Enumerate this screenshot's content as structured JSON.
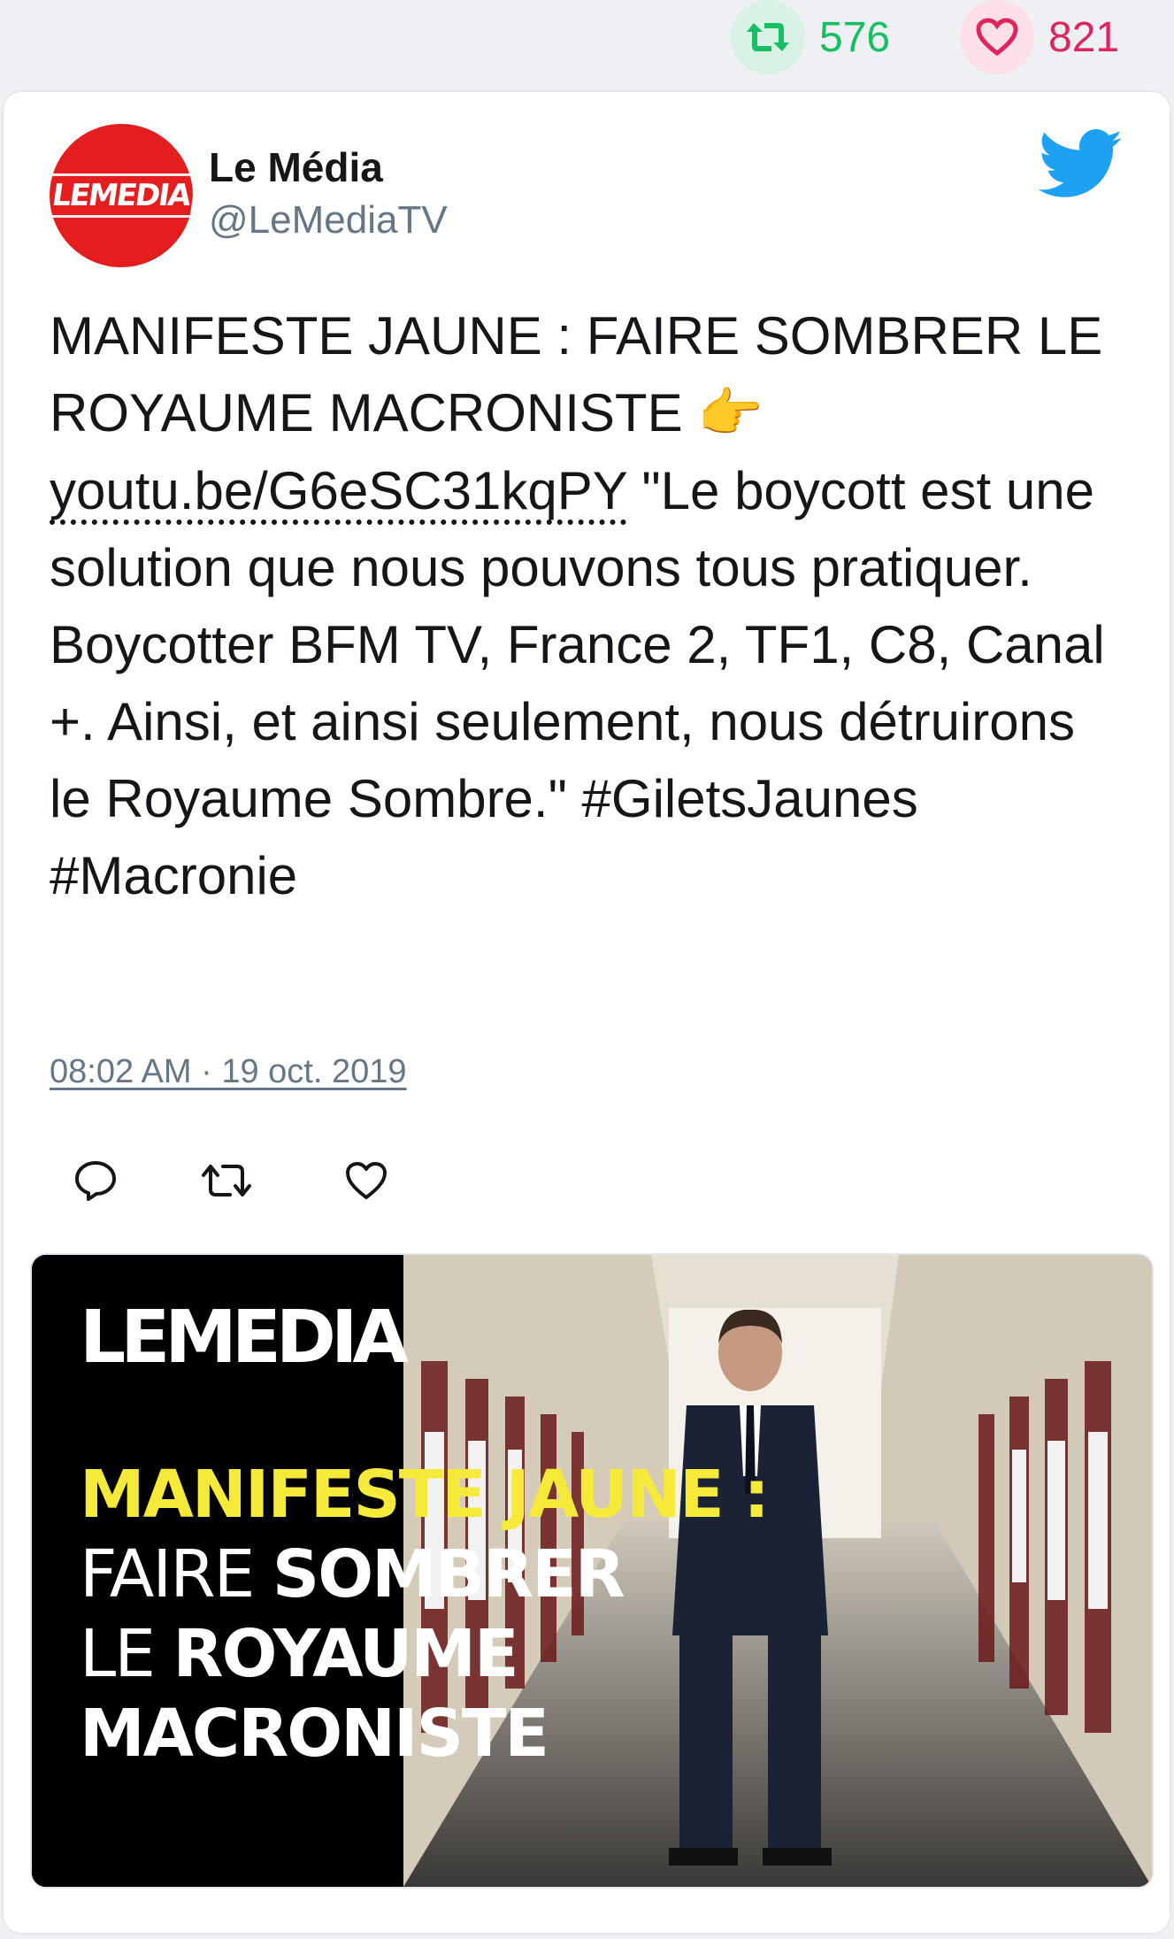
{
  "stats": {
    "retweets": "576",
    "likes": "821",
    "retweet_icon": "retweet-icon",
    "like_icon": "heart-icon"
  },
  "author": {
    "name": "Le Média",
    "handle": "@LeMediaTV",
    "avatar_text": "LEMEDIA"
  },
  "tweet": {
    "text_part1": "MANIFESTE JAUNE : FAIRE SOMBRER LE ROYAUME MACRONISTE ",
    "emoji": "👉",
    "link": "youtu.be/G6eSC31kqPY",
    "text_part2": " \"Le boycott est une solution que nous pouvons tous pratiquer. Boycotter BFM TV, France 2, TF1, C8, Canal +. Ainsi, et ainsi seulement, nous détruirons le Royaume Sombre.\" #GiletsJaunes #Macronie",
    "timestamp": "08:02 AM · 19 oct. 2019"
  },
  "media": {
    "logo": "LEMEDIA",
    "headline_line1": "MANIFESTE JAUNE :",
    "headline_line2_thin": "FAIRE ",
    "headline_line2_bold": "SOMBRER",
    "headline_line3_thin": "LE ",
    "headline_line3_bold": "ROYAUME",
    "headline_line4": "MACRONISTE"
  },
  "colors": {
    "retweet_green": "#17bf63",
    "like_red": "#e0245e",
    "twitter_blue": "#1da1f2",
    "brand_red": "#e41e1e",
    "headline_yellow": "#f5e93a"
  }
}
